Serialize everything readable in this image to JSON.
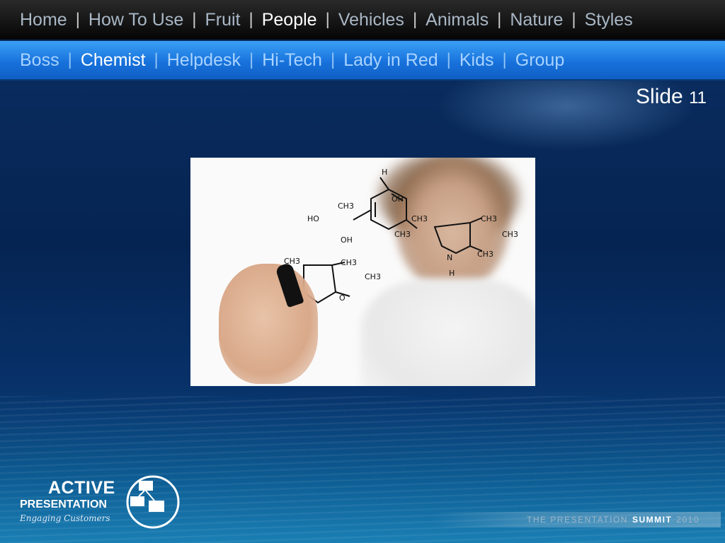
{
  "top_nav": {
    "items": [
      {
        "label": "Home"
      },
      {
        "label": "How To Use"
      },
      {
        "label": "Fruit"
      },
      {
        "label": "People"
      },
      {
        "label": "Vehicles"
      },
      {
        "label": "Animals"
      },
      {
        "label": "Nature"
      },
      {
        "label": "Styles"
      }
    ],
    "separator": "|",
    "active": "People"
  },
  "sub_nav": {
    "items": [
      {
        "label": "Boss"
      },
      {
        "label": "Chemist"
      },
      {
        "label": "Helpdesk"
      },
      {
        "label": "Hi-Tech"
      },
      {
        "label": "Lady in Red"
      },
      {
        "label": "Kids"
      },
      {
        "label": "Group"
      }
    ],
    "separator": "|",
    "active": "Chemist"
  },
  "slide": {
    "label": "Slide",
    "number": "11"
  },
  "molecule_labels": [
    "H",
    "OH",
    "CH3",
    "HO",
    "OH",
    "CH3",
    "CH3",
    "CH3",
    "N",
    "H",
    "CH3",
    "CH3",
    "CH3",
    "CH3",
    "CH3",
    "O"
  ],
  "logo": {
    "line1": "ACTIVE",
    "line2": "PRESENTATION",
    "tagline": "Engaging Customers"
  },
  "footer": {
    "part1": "THE PRESENTATION",
    "part2": "SUMMIT",
    "part3": "2010"
  },
  "colors": {
    "top_nav_bg": "#0a0a0a",
    "sub_nav_bg": "#1872dc",
    "active_text": "#ffffff",
    "background": "#06285a"
  }
}
